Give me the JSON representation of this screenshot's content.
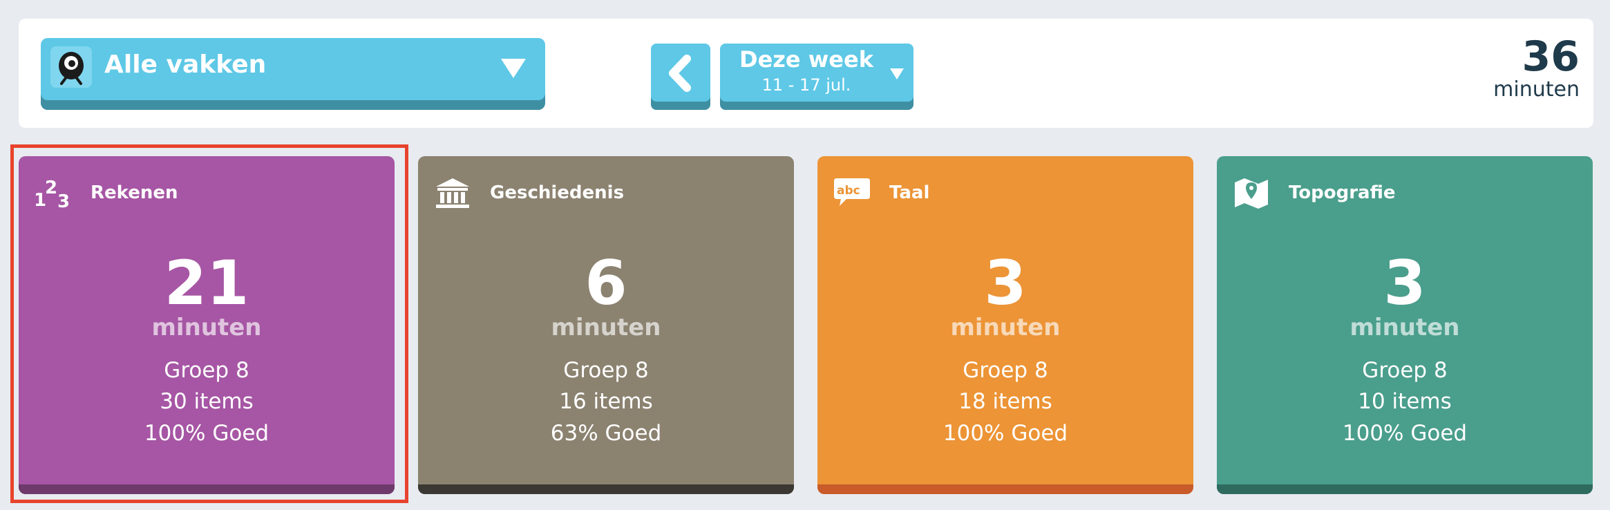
{
  "filter": {
    "subject_label": "Alle vakken",
    "mascot_icon": "mascot-icon"
  },
  "week": {
    "title": "Deze week",
    "range": "11 - 17 jul."
  },
  "total": {
    "value": "36",
    "unit": "minuten"
  },
  "cards": [
    {
      "name": "Rekenen",
      "minutes": "21",
      "unit": "minuten",
      "group": "Groep 8",
      "items": "30 items",
      "score": "100% Goed",
      "icon": "numbers-123-icon",
      "color": "#a656a4",
      "footer_color": "#6e3a6c"
    },
    {
      "name": "Geschiedenis",
      "minutes": "6",
      "unit": "minuten",
      "group": "Groep 8",
      "items": "16 items",
      "score": "63% Goed",
      "icon": "museum-icon",
      "color": "#8b8270",
      "footer_color": "#3b3833"
    },
    {
      "name": "Taal",
      "minutes": "3",
      "unit": "minuten",
      "group": "Groep 8",
      "items": "18 items",
      "score": "100% Goed",
      "icon": "abc-speech-bubble-icon",
      "color": "#ec9436",
      "footer_color": "#c95b2a"
    },
    {
      "name": "Topografie",
      "minutes": "3",
      "unit": "minuten",
      "group": "Groep 8",
      "items": "10 items",
      "score": "100% Goed",
      "icon": "map-pin-icon",
      "color": "#4a9e8c",
      "footer_color": "#2f6a5e"
    }
  ],
  "colors": {
    "accent_button": "#5ec8e6",
    "selection_outline": "#e8432c"
  }
}
